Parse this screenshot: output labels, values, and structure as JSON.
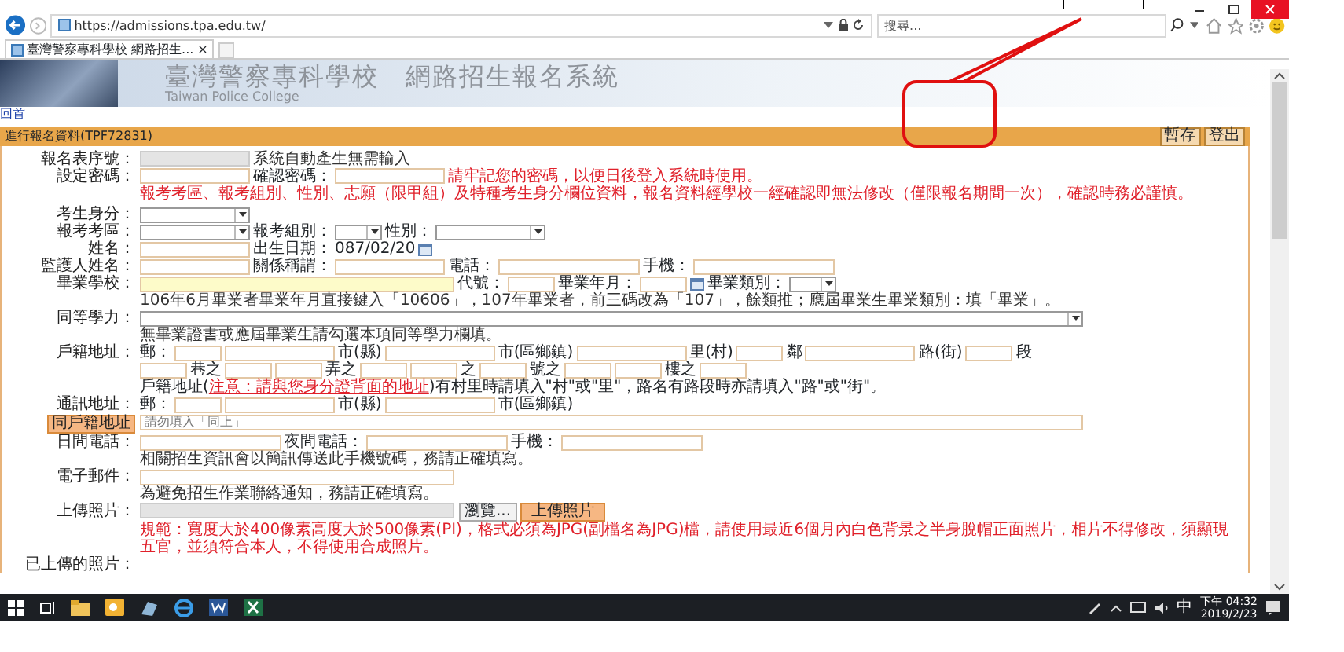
{
  "browser": {
    "url": "https://admissions.tpa.edu.tw/",
    "search_placeholder": "搜尋...",
    "tab_title": "臺灣警察專科學校 網路招生...",
    "tab_close": "×"
  },
  "site": {
    "title": "臺灣警察專科學校　網路招生報名系統",
    "subtitle": "Taiwan Police College",
    "home_link": "回首"
  },
  "section_bar": {
    "title": "進行報名資料(TPF72831)",
    "buttons": [
      "暫存",
      "登出"
    ]
  },
  "form": {
    "rows": [
      {
        "label": "報名表序號：",
        "lines": [
          [
            {
              "kind": "field",
              "disabled": true
            },
            {
              "kind": "hint",
              "text": "系統自動產生無需輸入"
            }
          ]
        ]
      },
      {
        "label": "設定密碼：",
        "lines": [
          [
            {
              "kind": "field",
              "disabled": false
            },
            {
              "kind": "text",
              "text": "確認密碼："
            },
            {
              "kind": "field",
              "disabled": false
            },
            {
              "kind": "warning",
              "text": "請牢記您的密碼，以便日後登入系統時使用。"
            }
          ],
          [
            {
              "kind": "warning",
              "text": "報考考區、報考組別、性別、志願（限甲組）及特種考生身分欄位資料，報名資料經學校一經確認即無法修改（僅限報名期間一次），確認時務必謹慎。"
            }
          ]
        ]
      },
      {
        "label": "考生身分：",
        "gap": true,
        "lines": [
          [
            {
              "kind": "select"
            }
          ]
        ]
      },
      {
        "label": "報考考區：",
        "lines": [
          [
            {
              "kind": "select"
            },
            {
              "kind": "text",
              "text": "報考組別："
            },
            {
              "kind": "minselect"
            },
            {
              "kind": "text",
              "text": "性別："
            },
            {
              "kind": "select"
            }
          ]
        ]
      },
      {
        "label": "姓名：",
        "lines": [
          [
            {
              "kind": "field",
              "disabled": false
            },
            {
              "kind": "text",
              "text": "出生日期："
            },
            {
              "kind": "value",
              "text": "087/02/20"
            },
            {
              "kind": "calendar"
            }
          ]
        ]
      },
      {
        "label": "監護人姓名：",
        "lines": [
          [
            {
              "kind": "field",
              "disabled": false
            },
            {
              "kind": "text",
              "text": "關係稱謂："
            },
            {
              "kind": "field",
              "disabled": false
            },
            {
              "kind": "text",
              "text": "電話："
            },
            {
              "kind": "midfield"
            },
            {
              "kind": "text",
              "text": "手機："
            },
            {
              "kind": "midfield"
            }
          ]
        ]
      },
      {
        "label": "畢業學校：",
        "lines": [
          [
            {
              "kind": "longfield",
              "highlighted": true
            },
            {
              "kind": "text",
              "text": "代號："
            },
            {
              "kind": "minifield"
            },
            {
              "kind": "text",
              "text": "畢業年月："
            },
            {
              "kind": "minifield"
            },
            {
              "kind": "calendar"
            },
            {
              "kind": "text",
              "text": "畢業類別："
            },
            {
              "kind": "minselect"
            }
          ],
          [
            {
              "kind": "hint",
              "text": "106年6月畢業者畢業年月直接鍵入「10606」，107年畢業者，前三碼改為「107」，餘類推；應屆畢業生畢業類別：填「畢業」。"
            }
          ]
        ]
      },
      {
        "label": "同等學力：",
        "lines": [
          [
            {
              "kind": "fullselect"
            }
          ],
          [
            {
              "kind": "hint",
              "text": "無畢業證書或應屆畢業生請勾選本項同等學力欄填。"
            }
          ]
        ]
      },
      {
        "label": "戶籍地址：",
        "lines": [
          [
            {
              "kind": "text",
              "text": "郵："
            },
            {
              "kind": "minifield"
            },
            {
              "kind": "field",
              "disabled": false
            },
            {
              "kind": "text",
              "text": "市(縣)"
            },
            {
              "kind": "field",
              "disabled": false
            },
            {
              "kind": "text",
              "text": "市(區鄉鎮)"
            },
            {
              "kind": "field",
              "disabled": false
            },
            {
              "kind": "text",
              "text": "里(村)"
            },
            {
              "kind": "minifield"
            },
            {
              "kind": "text",
              "text": "鄰"
            },
            {
              "kind": "field",
              "disabled": false
            },
            {
              "kind": "text",
              "text": "路(街)"
            },
            {
              "kind": "minifield"
            },
            {
              "kind": "text",
              "text": "段"
            }
          ],
          [
            {
              "kind": "minifield"
            },
            {
              "kind": "text",
              "text": "巷之"
            },
            {
              "kind": "minifield"
            },
            {
              "kind": "minifield"
            },
            {
              "kind": "text",
              "text": "弄之"
            },
            {
              "kind": "minifield"
            },
            {
              "kind": "minifield"
            },
            {
              "kind": "text",
              "text": "之"
            },
            {
              "kind": "minifield"
            },
            {
              "kind": "text",
              "text": "號之"
            },
            {
              "kind": "minifield"
            },
            {
              "kind": "minifield"
            },
            {
              "kind": "text",
              "text": "樓之"
            },
            {
              "kind": "minifield"
            }
          ],
          [
            {
              "kind": "linked",
              "before": "戶籍地址(",
              "link": "注意：請與您身分證背面的地址",
              "after": ")有村里時請填入\"村\"或\"里\"，路名有路段時亦請填入\"路\"或\"街\"。"
            }
          ]
        ]
      },
      {
        "label": "通訊地址：",
        "label_button": "同戶籍地址",
        "lines": [
          [
            {
              "kind": "text",
              "text": "郵："
            },
            {
              "kind": "minifield"
            },
            {
              "kind": "field",
              "disabled": false
            },
            {
              "kind": "text",
              "text": "市(縣)"
            },
            {
              "kind": "field",
              "disabled": false
            },
            {
              "kind": "text",
              "text": "市(區鄉鎮)"
            }
          ],
          [
            {
              "kind": "fullfield",
              "placeholder": "請勿填入「同上」"
            }
          ]
        ]
      },
      {
        "label": "日間電話：",
        "lines": [
          [
            {
              "kind": "midfield"
            },
            {
              "kind": "text",
              "text": "夜間電話："
            },
            {
              "kind": "midfield"
            },
            {
              "kind": "text",
              "text": "手機："
            },
            {
              "kind": "midfield"
            }
          ],
          [
            {
              "kind": "hint",
              "text": "相關招生資訊會以簡訊傳送此手機號碼，務請正確填寫。"
            }
          ]
        ]
      },
      {
        "label": "電子郵件：",
        "lines": [
          [
            {
              "kind": "longfield",
              "highlighted": false
            }
          ],
          [
            {
              "kind": "hint",
              "text": "為避免招生作業聯絡通知，務請正確填寫。"
            }
          ]
        ]
      },
      {
        "label": "上傳照片：",
        "lines": [
          [
            {
              "kind": "file",
              "button": "瀏覽..."
            },
            {
              "kind": "button",
              "text": "上傳照片"
            }
          ],
          [
            {
              "kind": "warning",
              "text": "規範：寬度大於400像素高度大於500像素(PI)，格式必須為JPG(副檔名為JPG)檔，請使用最近6個月內白色背景之半身脫帽正面照片，相片不得修改，須顯現五官，並須符合本人，不得使用合成照片。"
            }
          ]
        ]
      },
      {
        "label": "已上傳的照片："
      }
    ]
  },
  "taskbar": {
    "ime": "中",
    "time": "下午 04:32",
    "date": "2019/2/23"
  }
}
